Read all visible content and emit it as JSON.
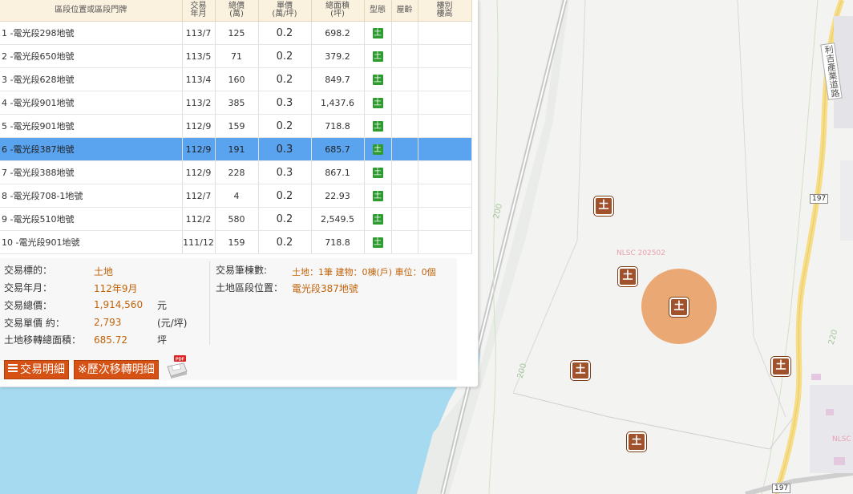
{
  "table": {
    "headers": {
      "location": "區段位置或區段門牌",
      "date": [
        "交易",
        "年月"
      ],
      "total": [
        "總價",
        "(萬)"
      ],
      "unit": [
        "單價",
        "(萬/坪)"
      ],
      "area": [
        "總面積",
        "(坪)"
      ],
      "type": "型態",
      "age": "屋齡",
      "floor": [
        "樓別",
        "樓高"
      ]
    },
    "rows": [
      {
        "location": "1 -電光段298地號",
        "date": "113/7",
        "total": "125",
        "unit": "0.2",
        "area": "698.2",
        "type": "土",
        "age": "",
        "floor": "",
        "selected": false
      },
      {
        "location": "2 -電光段650地號",
        "date": "113/5",
        "total": "71",
        "unit": "0.2",
        "area": "379.2",
        "type": "土",
        "age": "",
        "floor": "",
        "selected": false
      },
      {
        "location": "3 -電光段628地號",
        "date": "113/4",
        "total": "160",
        "unit": "0.2",
        "area": "849.7",
        "type": "土",
        "age": "",
        "floor": "",
        "selected": false
      },
      {
        "location": "4 -電光段901地號",
        "date": "113/2",
        "total": "385",
        "unit": "0.3",
        "area": "1,437.6",
        "type": "土",
        "age": "",
        "floor": "",
        "selected": false
      },
      {
        "location": "5 -電光段901地號",
        "date": "112/9",
        "total": "159",
        "unit": "0.2",
        "area": "718.8",
        "type": "土",
        "age": "",
        "floor": "",
        "selected": false
      },
      {
        "location": "6 -電光段387地號",
        "date": "112/9",
        "total": "191",
        "unit": "0.3",
        "area": "685.7",
        "type": "土",
        "age": "",
        "floor": "",
        "selected": true
      },
      {
        "location": "7 -電光段388地號",
        "date": "112/9",
        "total": "228",
        "unit": "0.3",
        "area": "867.1",
        "type": "土",
        "age": "",
        "floor": "",
        "selected": false
      },
      {
        "location": "8 -電光段708-1地號",
        "date": "112/7",
        "total": "4",
        "unit": "0.2",
        "area": "22.93",
        "type": "土",
        "age": "",
        "floor": "",
        "selected": false
      },
      {
        "location": "9 -電光段510地號",
        "date": "112/2",
        "total": "580",
        "unit": "0.2",
        "area": "2,549.5",
        "type": "土",
        "age": "",
        "floor": "",
        "selected": false
      },
      {
        "location": "10 -電光段901地號",
        "date": "111/12",
        "total": "159",
        "unit": "0.2",
        "area": "718.8",
        "type": "土",
        "age": "",
        "floor": "",
        "selected": false
      }
    ]
  },
  "detail": {
    "target_label": "交易標的：",
    "target_value": "土地",
    "date_label": "交易年月：",
    "date_value": "112年9月",
    "total_label": "交易總價：",
    "total_value": "1,914,560",
    "total_unit": "元",
    "unit_label": "交易單價 約：",
    "unit_value": "2,793",
    "unit_unit": "(元/坪)",
    "area_label": "土地移轉總面積：",
    "area_value": "685.72",
    "area_unit": "坪",
    "count_label": "交易筆棟數:",
    "count_value": "土地：1筆 建物：0棟(戶) 車位：0個",
    "section_label": "土地區段位置：",
    "section_value": "電光段387地號"
  },
  "buttons": {
    "detail_label": "交易明細",
    "history_label": "※歷次移轉明細",
    "pdf_label": "PDF"
  },
  "map": {
    "marker_glyph": "土",
    "nlsc_label_1": "NLSC 202502",
    "nlsc_label_2": "NLSC",
    "contour_1": "200",
    "contour_2": "200",
    "contour_3": "220",
    "road_name": "利吉產業道路",
    "road_shield_1": "197",
    "road_shield_2": "197",
    "colors": {
      "river": "#a6daf0",
      "road": "#f6dd86",
      "marker": "#a0522d",
      "highlight": "#e89a5e",
      "selected_row": "#5aa3ef",
      "type_badge": "#2e9b2e",
      "accent_text": "#c1630a",
      "button": "#d55214"
    }
  }
}
